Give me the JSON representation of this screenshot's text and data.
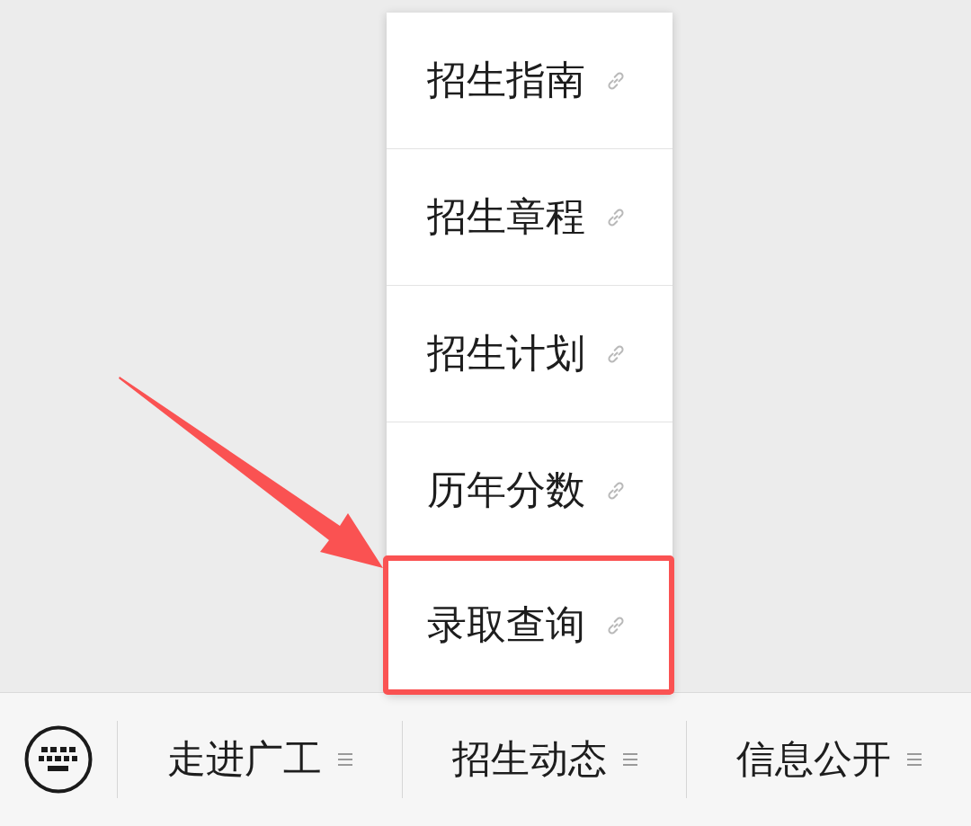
{
  "popup_menu": {
    "items": [
      {
        "label": "招生指南",
        "highlighted": false
      },
      {
        "label": "招生章程",
        "highlighted": false
      },
      {
        "label": "招生计划",
        "highlighted": false
      },
      {
        "label": "历年分数",
        "highlighted": false
      },
      {
        "label": "录取查询",
        "highlighted": true
      }
    ]
  },
  "bottom_bar": {
    "menus": [
      {
        "label": "走进广工"
      },
      {
        "label": "招生动态"
      },
      {
        "label": "信息公开"
      }
    ]
  }
}
